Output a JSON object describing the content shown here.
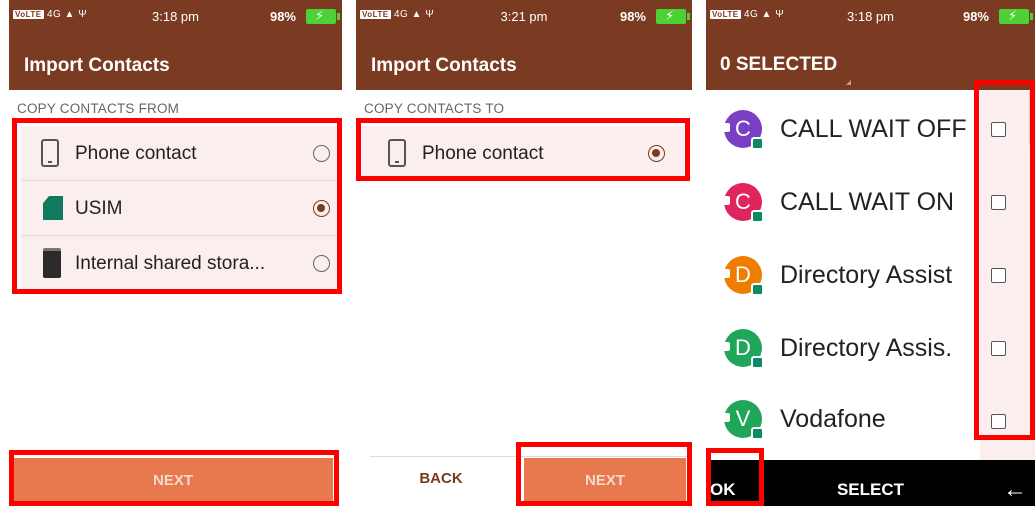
{
  "screens": [
    {
      "status": {
        "network": "4G",
        "time": "3:18 pm",
        "battery": "98%"
      },
      "title": "Import Contacts",
      "section": "COPY CONTACTS FROM",
      "options": [
        {
          "icon": "phone-icon",
          "label": "Phone contact",
          "selected": false
        },
        {
          "icon": "sim-card-icon",
          "label": "USIM",
          "selected": true
        },
        {
          "icon": "storage-icon",
          "label": "Internal shared stora...",
          "selected": false
        }
      ],
      "next_label": "NEXT"
    },
    {
      "status": {
        "network": "4G",
        "time": "3:21 pm",
        "battery": "98%"
      },
      "title": "Import Contacts",
      "section": "COPY CONTACTS TO",
      "options": [
        {
          "icon": "phone-icon",
          "label": "Phone contact",
          "selected": true
        }
      ],
      "back_label": "BACK",
      "next_label": "NEXT"
    },
    {
      "status": {
        "network": "4G",
        "time": "3:18 pm",
        "battery": "98%"
      },
      "title": "0 SELECTED",
      "contacts": [
        {
          "initial": "C",
          "name": "CALL WAIT OFF",
          "color": "#7b3fc4",
          "checked": false
        },
        {
          "initial": "C",
          "name": "CALL WAIT ON",
          "color": "#e0245e",
          "checked": false
        },
        {
          "initial": "D",
          "name": "Directory Assist",
          "color": "#ef7d00",
          "checked": false
        },
        {
          "initial": "D",
          "name": "Directory Assis.",
          "color": "#1fa65b",
          "checked": false
        },
        {
          "initial": "V",
          "name": "Vodafone",
          "color": "#1fa65b",
          "checked": false
        }
      ],
      "softkeys": {
        "left": "OK",
        "center": "SELECT",
        "right": "←"
      }
    }
  ],
  "colors": {
    "header": "#7a3b22",
    "accent_button": "#e8794e",
    "highlight_box": "#ff0000",
    "row_bg": "#faeeee"
  }
}
